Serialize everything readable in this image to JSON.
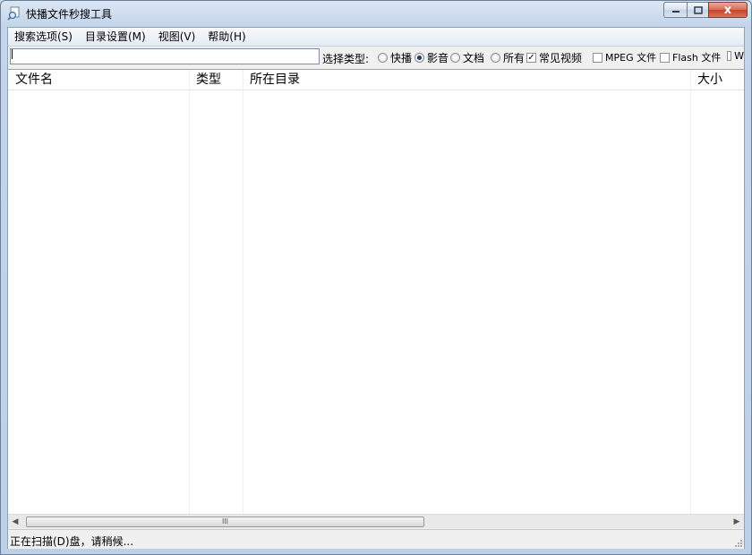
{
  "window": {
    "title": "快播文件秒搜工具",
    "close_glyph": "x"
  },
  "menu": [
    {
      "label": "搜索选项(S)"
    },
    {
      "label": "目录设置(M)"
    },
    {
      "label": "视图(V)"
    },
    {
      "label": "帮助(H)"
    }
  ],
  "search": {
    "value": "",
    "placeholder": ""
  },
  "filter": {
    "label": "选择类型:",
    "radios": [
      {
        "label": "快播",
        "selected": false
      },
      {
        "label": "影音",
        "selected": true
      },
      {
        "label": "文档",
        "selected": false
      },
      {
        "label": "所有",
        "selected": false
      }
    ],
    "checkboxes": [
      {
        "label": "常见视频",
        "checked": true
      },
      {
        "label": "MPEG 文件",
        "checked": false
      },
      {
        "label": "Flash 文件",
        "checked": false
      },
      {
        "label": "W",
        "checked": false
      }
    ]
  },
  "table": {
    "columns": [
      "文件名",
      "类型",
      "所在目录",
      "大小"
    ],
    "rows": []
  },
  "scrollbar": {
    "thumb_glyph": "III",
    "left_glyph": "◀",
    "right_glyph": "▶"
  },
  "status": {
    "text": "正在扫描(D)盘，请稍候..."
  }
}
